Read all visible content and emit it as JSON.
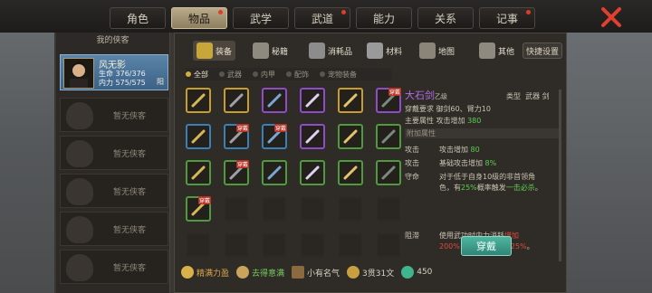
{
  "tabs": [
    {
      "label": "角色",
      "active": false,
      "dot": false
    },
    {
      "label": "物品",
      "active": true,
      "dot": true
    },
    {
      "label": "武学",
      "active": false,
      "dot": false
    },
    {
      "label": "武道",
      "active": false,
      "dot": true
    },
    {
      "label": "能力",
      "active": false,
      "dot": false
    },
    {
      "label": "关系",
      "active": false,
      "dot": false
    },
    {
      "label": "记事",
      "active": false,
      "dot": true
    }
  ],
  "left": {
    "title": "我的侠客",
    "hero": {
      "name": "风无影",
      "hp": "生命 376/376",
      "mp": "内力 575/575",
      "tag": "阳"
    },
    "empty_label": "暂无侠客",
    "empty_count": 5
  },
  "categories": [
    {
      "label": "装备",
      "color": "#c9a63a"
    },
    {
      "label": "秘籍",
      "color": "#8e8a80"
    },
    {
      "label": "消耗品",
      "color": "#8c8c8c"
    },
    {
      "label": "材料",
      "color": "#9a9a9a"
    },
    {
      "label": "地图",
      "color": "#8b8478"
    },
    {
      "label": "其他",
      "color": "#8e8a80"
    }
  ],
  "quick_setting": "快捷设置",
  "filters": [
    "全部",
    "武器",
    "内甲",
    "配饰",
    "宠物装备"
  ],
  "grid": [
    [
      "gold",
      "gold",
      "purple",
      "purple",
      "gold",
      "purple"
    ],
    [
      "blue",
      "blue",
      "blue",
      "purple",
      "green",
      "green"
    ],
    [
      "green",
      "green",
      "green",
      "green",
      "green",
      "green"
    ],
    [
      "green",
      "empty",
      "empty",
      "empty",
      "empty",
      "empty"
    ],
    [
      "empty",
      "empty",
      "empty",
      "empty",
      "empty",
      "empty"
    ]
  ],
  "badge_text": "穿戴",
  "detail": {
    "name": "大石剑",
    "grade": "乙级",
    "type_label": "类型",
    "type_value": "武器 剑",
    "req_label": "穿戴要求",
    "req_value": "御剑60、臂力10",
    "main_label": "主要属性",
    "main_value_prefix": "攻击增加",
    "main_value_num": "380",
    "extra_section": "附加属性",
    "attrs": [
      {
        "label": "攻击",
        "text_prefix": "攻击增加",
        "num": "80",
        "tail": ""
      },
      {
        "label": "攻击",
        "text_prefix": "基础攻击增加",
        "num": "8%",
        "tail": ""
      }
    ],
    "guard_label": "守命",
    "guard_text1": "对于低于自身10级的非首领角",
    "guard_text2a": "色，有",
    "guard_text2b": "25%",
    "guard_text2c": "概率触发",
    "guard_text2d": "一击必杀",
    "guard_text2e": "。",
    "block_label": "阻滞",
    "block_text1a": "使用武功时内力消耗",
    "block_text1b": "增加",
    "block_text2a": "200%",
    "block_text2b": "，",
    "block_text2c": "集气速度降低25%",
    "block_text2d": "。"
  },
  "wear_button": "穿戴",
  "bottom": {
    "item1": "精满力盈",
    "item2": "去得意满",
    "item3": "小有名气",
    "item4": "3贯31文",
    "item5": "450"
  }
}
